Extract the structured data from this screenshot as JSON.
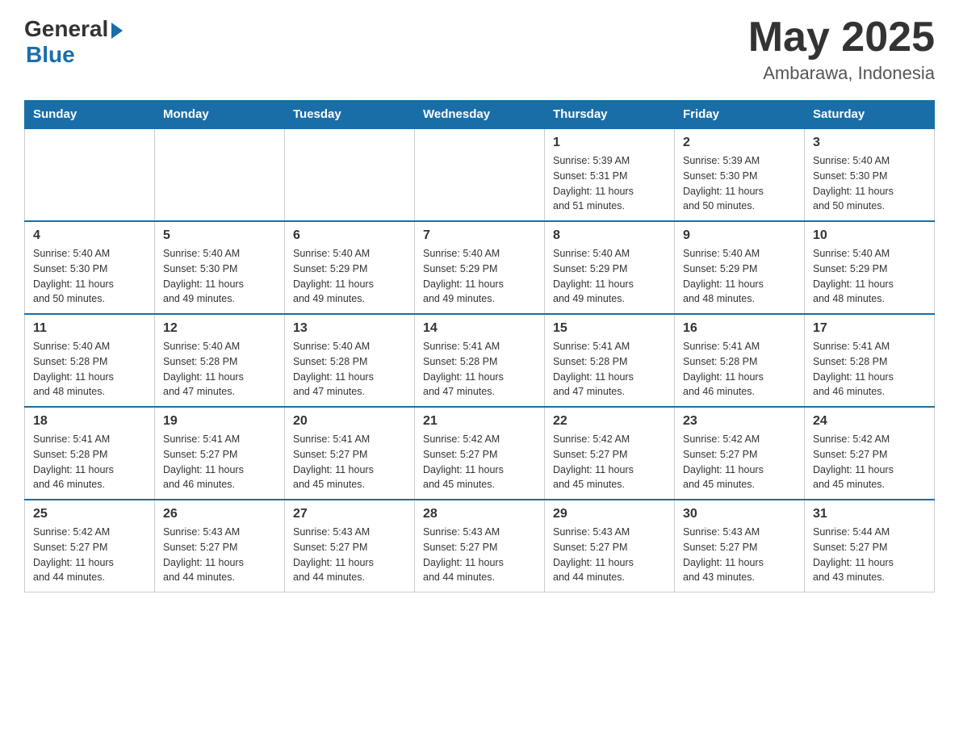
{
  "header": {
    "logo_general": "General",
    "logo_blue": "Blue",
    "month_title": "May 2025",
    "location": "Ambarawa, Indonesia"
  },
  "days_of_week": [
    "Sunday",
    "Monday",
    "Tuesday",
    "Wednesday",
    "Thursday",
    "Friday",
    "Saturday"
  ],
  "weeks": [
    [
      {
        "day": "",
        "info": ""
      },
      {
        "day": "",
        "info": ""
      },
      {
        "day": "",
        "info": ""
      },
      {
        "day": "",
        "info": ""
      },
      {
        "day": "1",
        "info": "Sunrise: 5:39 AM\nSunset: 5:31 PM\nDaylight: 11 hours\nand 51 minutes."
      },
      {
        "day": "2",
        "info": "Sunrise: 5:39 AM\nSunset: 5:30 PM\nDaylight: 11 hours\nand 50 minutes."
      },
      {
        "day": "3",
        "info": "Sunrise: 5:40 AM\nSunset: 5:30 PM\nDaylight: 11 hours\nand 50 minutes."
      }
    ],
    [
      {
        "day": "4",
        "info": "Sunrise: 5:40 AM\nSunset: 5:30 PM\nDaylight: 11 hours\nand 50 minutes."
      },
      {
        "day": "5",
        "info": "Sunrise: 5:40 AM\nSunset: 5:30 PM\nDaylight: 11 hours\nand 49 minutes."
      },
      {
        "day": "6",
        "info": "Sunrise: 5:40 AM\nSunset: 5:29 PM\nDaylight: 11 hours\nand 49 minutes."
      },
      {
        "day": "7",
        "info": "Sunrise: 5:40 AM\nSunset: 5:29 PM\nDaylight: 11 hours\nand 49 minutes."
      },
      {
        "day": "8",
        "info": "Sunrise: 5:40 AM\nSunset: 5:29 PM\nDaylight: 11 hours\nand 49 minutes."
      },
      {
        "day": "9",
        "info": "Sunrise: 5:40 AM\nSunset: 5:29 PM\nDaylight: 11 hours\nand 48 minutes."
      },
      {
        "day": "10",
        "info": "Sunrise: 5:40 AM\nSunset: 5:29 PM\nDaylight: 11 hours\nand 48 minutes."
      }
    ],
    [
      {
        "day": "11",
        "info": "Sunrise: 5:40 AM\nSunset: 5:28 PM\nDaylight: 11 hours\nand 48 minutes."
      },
      {
        "day": "12",
        "info": "Sunrise: 5:40 AM\nSunset: 5:28 PM\nDaylight: 11 hours\nand 47 minutes."
      },
      {
        "day": "13",
        "info": "Sunrise: 5:40 AM\nSunset: 5:28 PM\nDaylight: 11 hours\nand 47 minutes."
      },
      {
        "day": "14",
        "info": "Sunrise: 5:41 AM\nSunset: 5:28 PM\nDaylight: 11 hours\nand 47 minutes."
      },
      {
        "day": "15",
        "info": "Sunrise: 5:41 AM\nSunset: 5:28 PM\nDaylight: 11 hours\nand 47 minutes."
      },
      {
        "day": "16",
        "info": "Sunrise: 5:41 AM\nSunset: 5:28 PM\nDaylight: 11 hours\nand 46 minutes."
      },
      {
        "day": "17",
        "info": "Sunrise: 5:41 AM\nSunset: 5:28 PM\nDaylight: 11 hours\nand 46 minutes."
      }
    ],
    [
      {
        "day": "18",
        "info": "Sunrise: 5:41 AM\nSunset: 5:28 PM\nDaylight: 11 hours\nand 46 minutes."
      },
      {
        "day": "19",
        "info": "Sunrise: 5:41 AM\nSunset: 5:27 PM\nDaylight: 11 hours\nand 46 minutes."
      },
      {
        "day": "20",
        "info": "Sunrise: 5:41 AM\nSunset: 5:27 PM\nDaylight: 11 hours\nand 45 minutes."
      },
      {
        "day": "21",
        "info": "Sunrise: 5:42 AM\nSunset: 5:27 PM\nDaylight: 11 hours\nand 45 minutes."
      },
      {
        "day": "22",
        "info": "Sunrise: 5:42 AM\nSunset: 5:27 PM\nDaylight: 11 hours\nand 45 minutes."
      },
      {
        "day": "23",
        "info": "Sunrise: 5:42 AM\nSunset: 5:27 PM\nDaylight: 11 hours\nand 45 minutes."
      },
      {
        "day": "24",
        "info": "Sunrise: 5:42 AM\nSunset: 5:27 PM\nDaylight: 11 hours\nand 45 minutes."
      }
    ],
    [
      {
        "day": "25",
        "info": "Sunrise: 5:42 AM\nSunset: 5:27 PM\nDaylight: 11 hours\nand 44 minutes."
      },
      {
        "day": "26",
        "info": "Sunrise: 5:43 AM\nSunset: 5:27 PM\nDaylight: 11 hours\nand 44 minutes."
      },
      {
        "day": "27",
        "info": "Sunrise: 5:43 AM\nSunset: 5:27 PM\nDaylight: 11 hours\nand 44 minutes."
      },
      {
        "day": "28",
        "info": "Sunrise: 5:43 AM\nSunset: 5:27 PM\nDaylight: 11 hours\nand 44 minutes."
      },
      {
        "day": "29",
        "info": "Sunrise: 5:43 AM\nSunset: 5:27 PM\nDaylight: 11 hours\nand 44 minutes."
      },
      {
        "day": "30",
        "info": "Sunrise: 5:43 AM\nSunset: 5:27 PM\nDaylight: 11 hours\nand 43 minutes."
      },
      {
        "day": "31",
        "info": "Sunrise: 5:44 AM\nSunset: 5:27 PM\nDaylight: 11 hours\nand 43 minutes."
      }
    ]
  ]
}
